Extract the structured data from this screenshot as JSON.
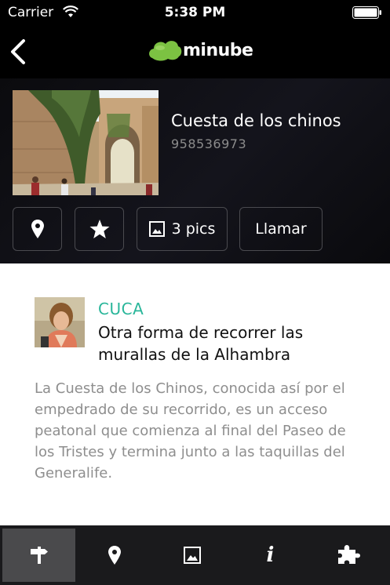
{
  "status_bar": {
    "carrier": "Carrier",
    "time": "5:38 PM"
  },
  "nav": {
    "back_icon": "chevron-left-icon",
    "logo_text": "minube",
    "logo_color": "#7cc242"
  },
  "place": {
    "name": "Cuesta de los chinos",
    "phone": "958536973",
    "actions": {
      "map_icon": "map-pin-icon",
      "favorite_icon": "star-icon",
      "pics_label": "3 pics",
      "call_label": "Llamar"
    }
  },
  "review": {
    "author": "CUCA",
    "author_color": "#29b69a",
    "title": "Otra forma de recorrer las murallas de la Alhambra",
    "body": "La Cuesta de los Chinos, conocida así por el empedrado de su recorrido, es un acceso peatonal que comienza al final del Paseo de los Tristes y termina junto a las taquillas del Generalife."
  },
  "tabs": [
    {
      "icon": "signpost-icon",
      "active": true
    },
    {
      "icon": "map-pin-icon",
      "active": false
    },
    {
      "icon": "photo-icon",
      "active": false
    },
    {
      "icon": "info-icon",
      "active": false
    },
    {
      "icon": "puzzle-icon",
      "active": false
    }
  ]
}
